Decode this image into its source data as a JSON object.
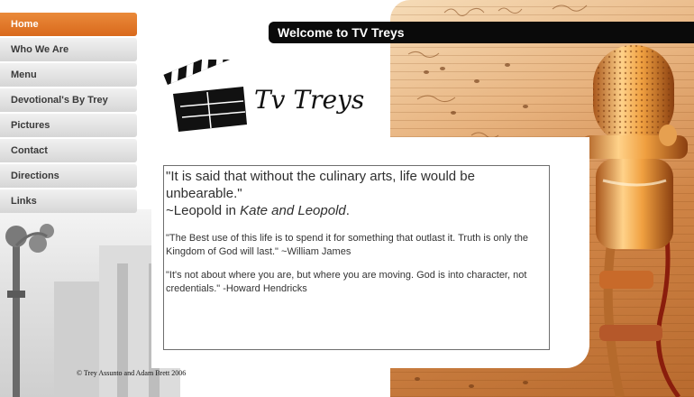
{
  "nav": {
    "items": [
      {
        "label": "Home"
      },
      {
        "label": "Who We Are"
      },
      {
        "label": "Menu"
      },
      {
        "label": "Devotional's By Trey"
      },
      {
        "label": "Pictures"
      },
      {
        "label": "Contact"
      },
      {
        "label": "Directions"
      },
      {
        "label": "Links"
      }
    ],
    "active_index": 0
  },
  "header": {
    "welcome": "Welcome to TV Treys"
  },
  "logo": {
    "text": "Tv Treys",
    "icon": "clapperboard-icon"
  },
  "quotes": {
    "q1_line1": "\"It is said that without the culinary arts, life would be unbearable.\"",
    "q1_prefix": "~Leopold in ",
    "q1_title": "Kate and Leopold",
    "q1_suffix": ".",
    "q2": "\"The Best use of this life is to spend it for something that outlast it. Truth is only the Kingdom of God will last.\" ~William James",
    "q3": "\"It's not about where you are, but where you are moving.  God is into character, not credentials.\"  -Howard Hendricks"
  },
  "footer": {
    "copyright": "© Trey Assunto and Adam Brett 2006"
  },
  "colors": {
    "accent": "#e27a2a",
    "header_bg": "#0a0a0a"
  }
}
